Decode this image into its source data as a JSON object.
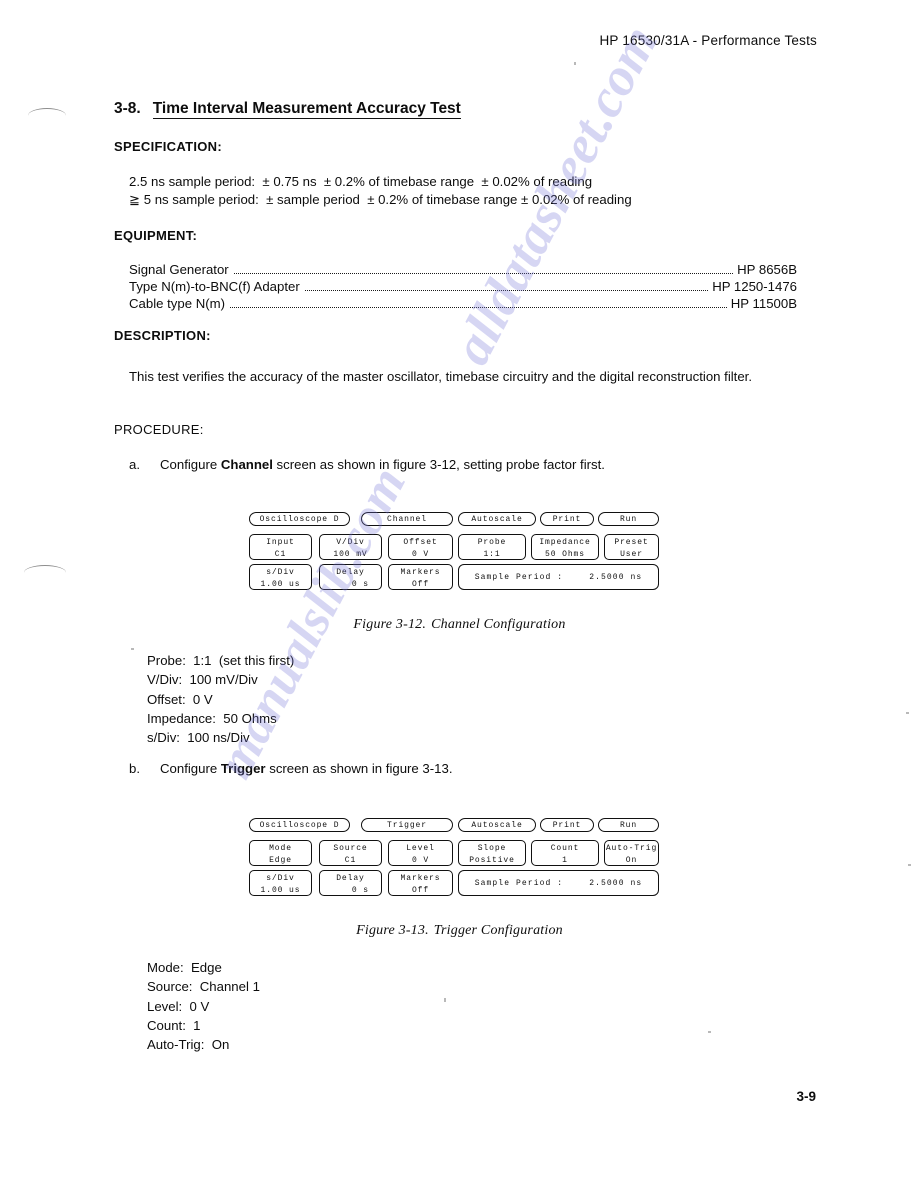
{
  "header": {
    "running_head": "HP 16530/31A - Performance Tests"
  },
  "section": {
    "number": "3-8.",
    "title": "Time Interval Measurement Accuracy Test"
  },
  "specification": {
    "label": "SPECIFICATION:",
    "lines": [
      "2.5 ns sample period:  ± 0.75 ns  ± 0.2% of timebase range  ± 0.02% of reading",
      "≧ 5 ns sample period:  ± sample period  ± 0.2% of timebase range ± 0.02% of reading"
    ]
  },
  "equipment": {
    "label": "EQUIPMENT:",
    "items": [
      {
        "name": "Signal Generator",
        "value": "HP 8656B"
      },
      {
        "name": "Type N(m)-to-BNC(f) Adapter",
        "value": "HP 1250-1476"
      },
      {
        "name": "Cable type N(m)",
        "value": "HP 11500B"
      }
    ]
  },
  "description": {
    "label": "DESCRIPTION:",
    "text": "This test verifies the accuracy of the master oscillator, timebase circuitry and the digital reconstruction filter."
  },
  "procedure": {
    "label": "PROCEDURE:",
    "steps": [
      {
        "letter": "a.",
        "text_before": "Configure ",
        "text_bold": "Channel",
        "text_after": " screen as shown in figure 3-12, setting probe factor first."
      },
      {
        "letter": "b.",
        "text_before": "Configure ",
        "text_bold": "Trigger",
        "text_after": " screen as shown in figure 3-13."
      }
    ]
  },
  "figure_channel": {
    "caption_num": "Figure 3-12.",
    "caption_text": "Channel Configuration",
    "row1": [
      {
        "label": "Oscilloscope D"
      },
      {
        "label": "Channel"
      },
      {
        "label": "Autoscale"
      },
      {
        "label": "Print"
      },
      {
        "label": "Run"
      }
    ],
    "row2": [
      {
        "label": "Input",
        "value": "C1"
      },
      {
        "label": "V/Div",
        "value": "100 mV"
      },
      {
        "label": "Offset",
        "value": "0  V"
      },
      {
        "label": "Probe",
        "value": "1:1"
      },
      {
        "label": "Impedance",
        "value": "50 Ohms"
      },
      {
        "label": "Preset",
        "value": "User"
      }
    ],
    "row3": [
      {
        "label": "s/Div",
        "value": "1.00 us"
      },
      {
        "label": "Delay",
        "value": "0  s"
      },
      {
        "label": "Markers",
        "value": "Off"
      }
    ],
    "sample_period": {
      "label": "Sample Period :",
      "value": "2.5000 ns"
    }
  },
  "channel_settings": {
    "lines": [
      "Probe:  1:1  (set this first)",
      "V/Div:  100 mV/Div",
      "Offset:  0 V",
      "Impedance:  50 Ohms",
      "s/Div:  100 ns/Div"
    ]
  },
  "figure_trigger": {
    "caption_num": "Figure 3-13.",
    "caption_text": "Trigger Configuration",
    "row1": [
      {
        "label": "Oscilloscope D"
      },
      {
        "label": "Trigger"
      },
      {
        "label": "Autoscale"
      },
      {
        "label": "Print"
      },
      {
        "label": "Run"
      }
    ],
    "row2": [
      {
        "label": "Mode",
        "value": "Edge"
      },
      {
        "label": "Source",
        "value": "C1"
      },
      {
        "label": "Level",
        "value": "0  V"
      },
      {
        "label": "Slope",
        "value": "Positive"
      },
      {
        "label": "Count",
        "value": "1"
      },
      {
        "label": "Auto-Trig",
        "value": "On"
      }
    ],
    "row3": [
      {
        "label": "s/Div",
        "value": "1.00 us"
      },
      {
        "label": "Delay",
        "value": "0  s"
      },
      {
        "label": "Markers",
        "value": "Off"
      }
    ],
    "sample_period": {
      "label": "Sample Period :",
      "value": "2.5000 ns"
    }
  },
  "trigger_settings": {
    "lines": [
      "Mode:  Edge",
      "Source:  Channel 1",
      "Level:  0 V",
      "Count:  1",
      "Auto-Trig:  On"
    ]
  },
  "footer": {
    "page_number": "3-9"
  },
  "watermark": {
    "line_a": "alldatasheet.com",
    "line_b": "manualslib.com"
  },
  "colors": {
    "ink": "#0d0d0d",
    "paper": "#ffffff",
    "watermark": "#7878d7"
  }
}
